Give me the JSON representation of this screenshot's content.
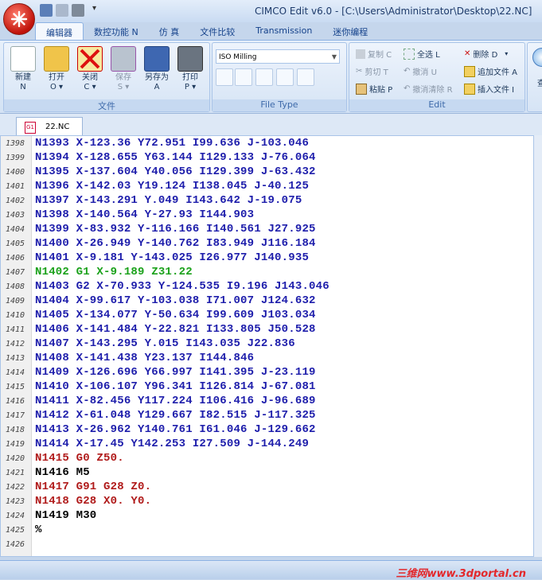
{
  "window": {
    "title": "CIMCO Edit v6.0 - [C:\\Users\\Administrator\\Desktop\\22.NC]"
  },
  "ribbon_tabs": [
    "编辑器",
    "数控功能 N",
    "仿 真",
    "文件比较",
    "Transmission",
    "迷你编程"
  ],
  "file_group": {
    "label": "文件",
    "buttons": [
      {
        "label": "新建",
        "key": "N"
      },
      {
        "label": "打开",
        "key": "O ▾"
      },
      {
        "label": "关闭",
        "key": "C ▾"
      },
      {
        "label": "保存",
        "key": "S ▾"
      },
      {
        "label": "另存为",
        "key": "A"
      },
      {
        "label": "打印",
        "key": "P ▾"
      }
    ]
  },
  "file_type_group": {
    "label": "File Type",
    "selected": "ISO Milling"
  },
  "edit_group": {
    "label": "Edit",
    "items": [
      {
        "label": "复制 C",
        "enabled": false
      },
      {
        "label": "全选 L",
        "enabled": true
      },
      {
        "label": "删除 D",
        "enabled": true
      },
      {
        "label": "剪切 T",
        "enabled": false
      },
      {
        "label": "撤消 U",
        "enabled": false
      },
      {
        "label": "追加文件 A",
        "enabled": true
      },
      {
        "label": "粘贴 P",
        "enabled": true
      },
      {
        "label": "撤消清除 R",
        "enabled": false
      },
      {
        "label": "插入文件 I",
        "enabled": true
      }
    ],
    "cut_off_label": "查"
  },
  "document_tab": {
    "name": "22.NC"
  },
  "colors": {
    "blue": "#1d1dab",
    "green": "#1aa11a",
    "red": "#b01a1a",
    "black": "#000000"
  },
  "lines": [
    {
      "num": "1398",
      "text": "N1393 X-123.36 Y72.951 I99.636 J-103.046",
      "color": "blue"
    },
    {
      "num": "1399",
      "text": "N1394 X-128.655 Y63.144 I129.133 J-76.064",
      "color": "blue"
    },
    {
      "num": "1400",
      "text": "N1395 X-137.604 Y40.056 I129.399 J-63.432",
      "color": "blue"
    },
    {
      "num": "1401",
      "text": "N1396 X-142.03 Y19.124 I138.045 J-40.125",
      "color": "blue"
    },
    {
      "num": "1402",
      "text": "N1397 X-143.291 Y.049 I143.642 J-19.075",
      "color": "blue"
    },
    {
      "num": "1403",
      "text": "N1398 X-140.564 Y-27.93 I144.903",
      "color": "blue"
    },
    {
      "num": "1404",
      "text": "N1399 X-83.932 Y-116.166 I140.561 J27.925",
      "color": "blue"
    },
    {
      "num": "1405",
      "text": "N1400 X-26.949 Y-140.762 I83.949 J116.184",
      "color": "blue"
    },
    {
      "num": "1406",
      "text": "N1401 X-9.181 Y-143.025 I26.977 J140.935",
      "color": "blue"
    },
    {
      "num": "1407",
      "text": "N1402 G1 X-9.189 Z31.22",
      "color": "green"
    },
    {
      "num": "1408",
      "text": "N1403 G2 X-70.933 Y-124.535 I9.196 J143.046",
      "color": "blue"
    },
    {
      "num": "1409",
      "text": "N1404 X-99.617 Y-103.038 I71.007 J124.632",
      "color": "blue"
    },
    {
      "num": "1410",
      "text": "N1405 X-134.077 Y-50.634 I99.609 J103.034",
      "color": "blue"
    },
    {
      "num": "1411",
      "text": "N1406 X-141.484 Y-22.821 I133.805 J50.528",
      "color": "blue"
    },
    {
      "num": "1412",
      "text": "N1407 X-143.295 Y.015 I143.035 J22.836",
      "color": "blue"
    },
    {
      "num": "1413",
      "text": "N1408 X-141.438 Y23.137 I144.846",
      "color": "blue"
    },
    {
      "num": "1414",
      "text": "N1409 X-126.696 Y66.997 I141.395 J-23.119",
      "color": "blue"
    },
    {
      "num": "1415",
      "text": "N1410 X-106.107 Y96.341 I126.814 J-67.081",
      "color": "blue"
    },
    {
      "num": "1416",
      "text": "N1411 X-82.456 Y117.224 I106.416 J-96.689",
      "color": "blue"
    },
    {
      "num": "1417",
      "text": "N1412 X-61.048 Y129.667 I82.515 J-117.325",
      "color": "blue"
    },
    {
      "num": "1418",
      "text": "N1413 X-26.962 Y140.761 I61.046 J-129.662",
      "color": "blue"
    },
    {
      "num": "1419",
      "text": "N1414 X-17.45 Y142.253 I27.509 J-144.249",
      "color": "blue"
    },
    {
      "num": "1420",
      "text": "N1415 G0 Z50.",
      "color": "red"
    },
    {
      "num": "1421",
      "text": "N1416 M5",
      "color": "black"
    },
    {
      "num": "1422",
      "text": "N1417 G91 G28 Z0.",
      "color": "red"
    },
    {
      "num": "1423",
      "text": "N1418 G28 X0. Y0.",
      "color": "red"
    },
    {
      "num": "1424",
      "text": "N1419 M30",
      "color": "black"
    },
    {
      "num": "1425",
      "text": "%",
      "color": "black"
    },
    {
      "num": "1426",
      "text": "",
      "color": "black"
    }
  ],
  "watermark": "三维网www.3dportal.cn"
}
